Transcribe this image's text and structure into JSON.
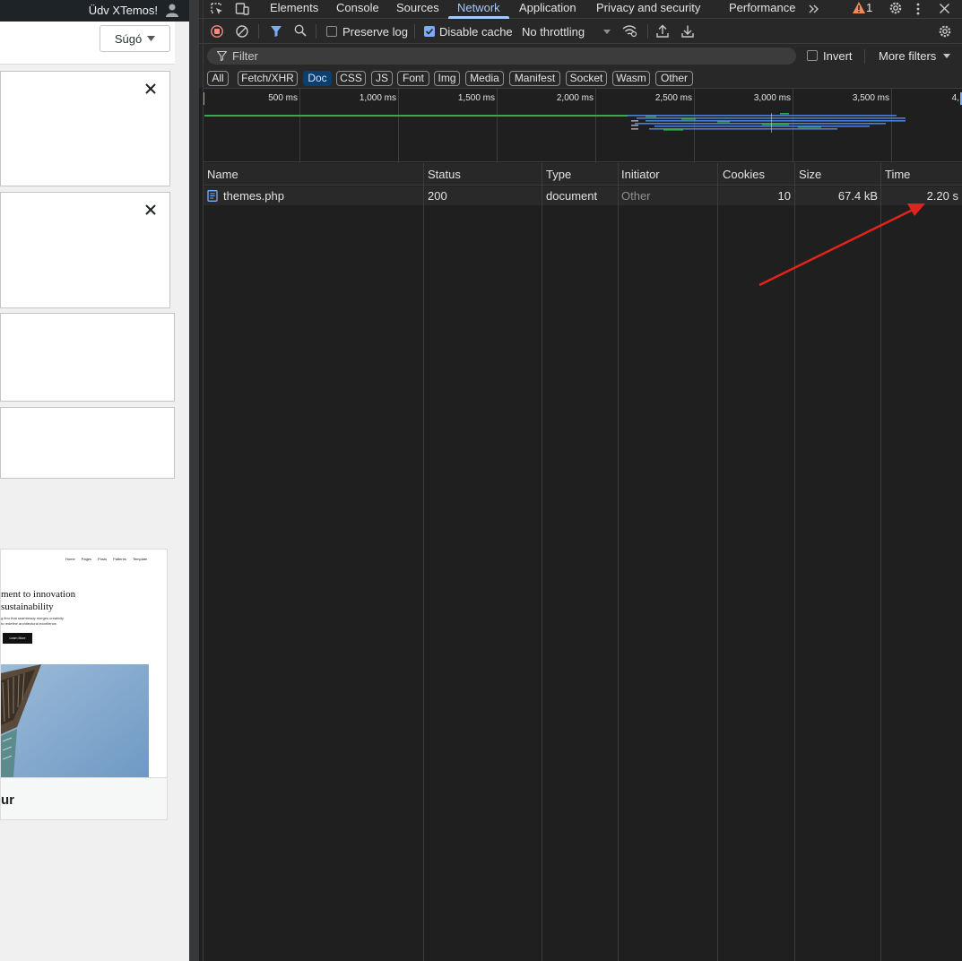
{
  "page": {
    "greeting": "Üdv XTemos!",
    "help_label": "Súgó",
    "theme_preview": {
      "nav": [
        "Home",
        "Pages",
        "Posts",
        "Patterns",
        "Template"
      ],
      "hero_line1": "ment to innovation",
      "hero_line2": "sustainability",
      "sub_line1": "g firm that seamlessly merges creativity",
      "sub_line2": "to redefine architectural excellence.",
      "button": "Learn More",
      "name": "ur"
    }
  },
  "devtools": {
    "tabs": [
      "Elements",
      "Console",
      "Sources",
      "Network",
      "Application",
      "Privacy and security",
      "Performance"
    ],
    "active_tab": "Network",
    "issues_count": "1",
    "toolbar": {
      "preserve_log": "Preserve log",
      "disable_cache": "Disable cache",
      "throttling": "No throttling"
    },
    "filter": {
      "placeholder": "Filter",
      "invert": "Invert",
      "more_filters": "More filters"
    },
    "type_filters": [
      "All",
      "Fetch/XHR",
      "Doc",
      "CSS",
      "JS",
      "Font",
      "Img",
      "Media",
      "Manifest",
      "Socket",
      "Wasm",
      "Other"
    ],
    "active_type": "Doc",
    "timeline_ticks": [
      "500 ms",
      "1,000 ms",
      "1,500 ms",
      "2,000 ms",
      "2,500 ms",
      "3,000 ms",
      "3,500 ms",
      "4,"
    ],
    "columns": [
      "Name",
      "Status",
      "Type",
      "Initiator",
      "Cookies",
      "Size",
      "Time"
    ],
    "rows": [
      {
        "name": "themes.php",
        "status": "200",
        "type": "document",
        "initiator": "Other",
        "cookies": "10",
        "size": "67.4 kB",
        "time": "2.20 s"
      }
    ],
    "colors": {
      "accent": "#a8c7fa",
      "active_chip": "#0b3f6e",
      "annotation_arrow": "#e0241b"
    }
  }
}
